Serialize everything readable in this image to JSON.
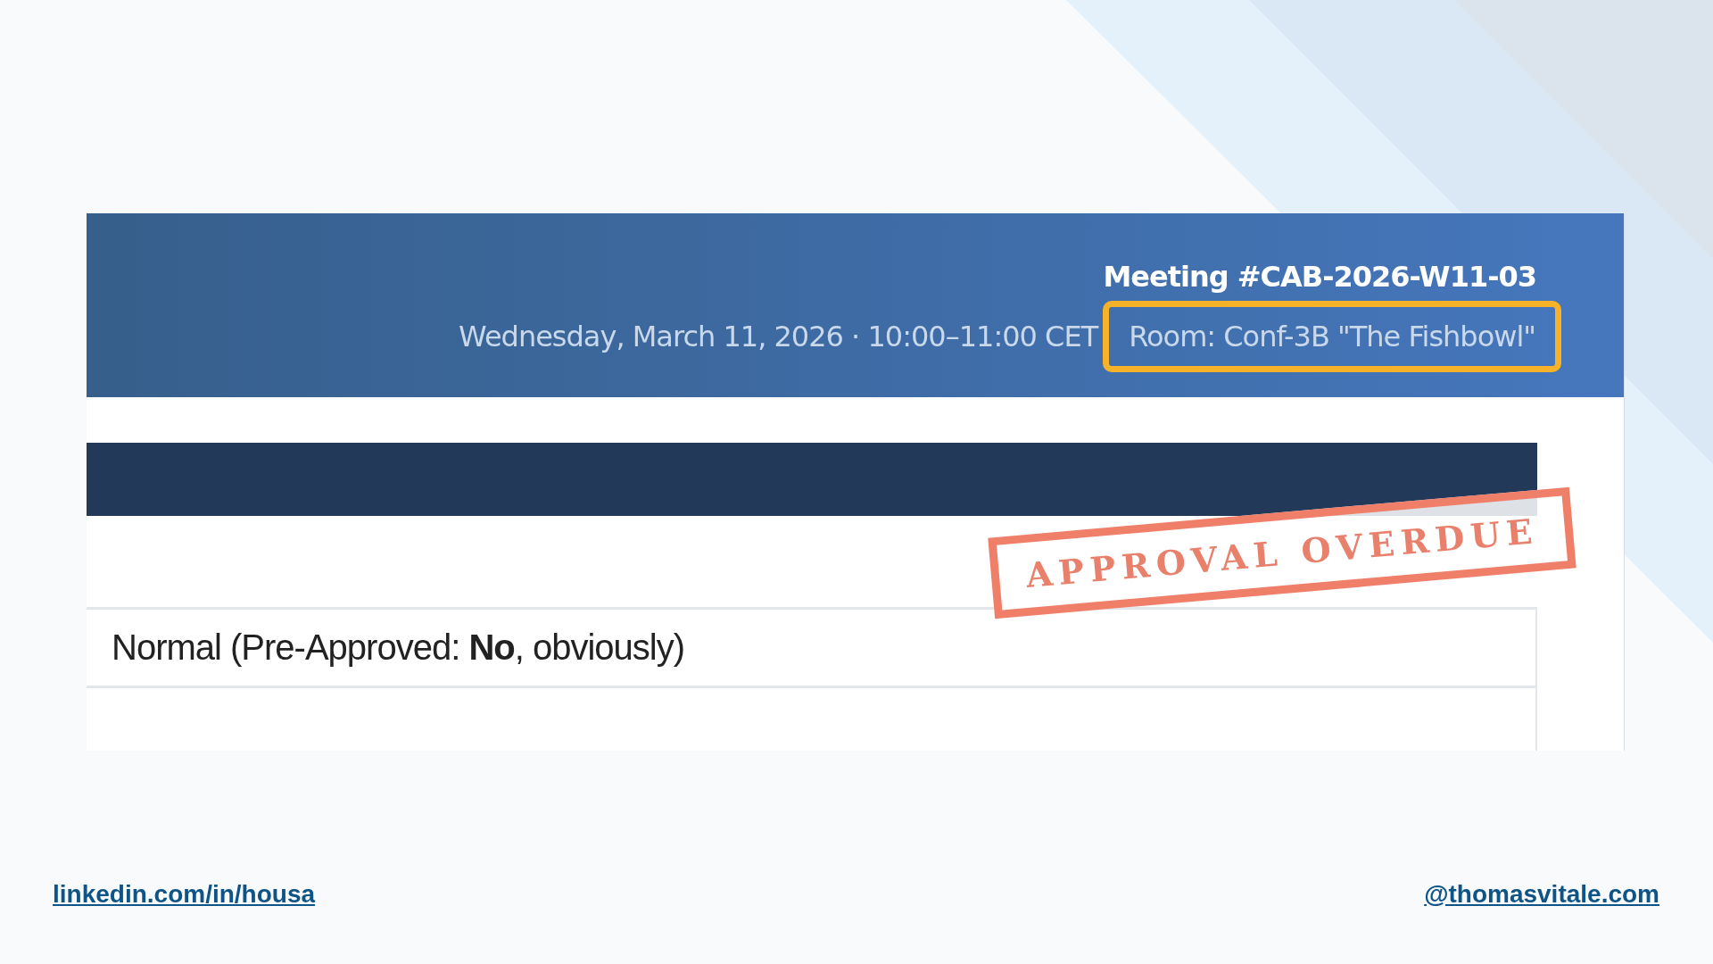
{
  "header": {
    "meeting_title": "Meeting #CAB-2026-W11-03",
    "schedule": "Wednesday, March 11, 2026 · 10:00–11:00 CET",
    "room": "Room: Conf-3B \"The Fishbowl\"",
    "room_highlighted": true
  },
  "stamp": {
    "text": "APPROVAL OVERDUE"
  },
  "row": {
    "value": "Normal (Pre-Approved: **No**, obviously)"
  },
  "footer": {
    "left_link": "linkedin.com/in/housa",
    "right_link": "@thomasvitale.com"
  }
}
